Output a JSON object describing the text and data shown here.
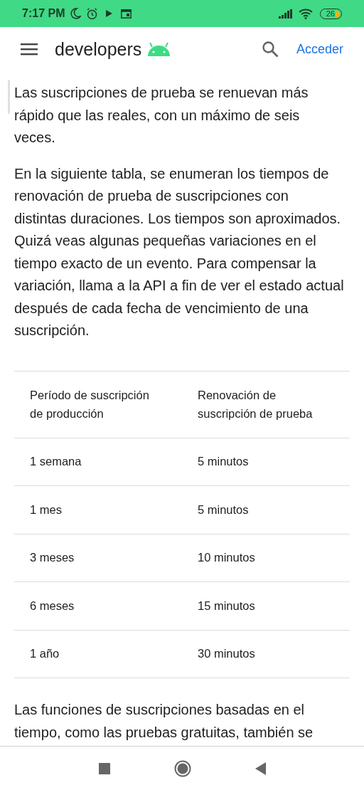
{
  "status_bar": {
    "time": "7:17 PM",
    "battery": "26"
  },
  "header": {
    "logo": "developers",
    "sign_in": "Acceder"
  },
  "paragraphs": [
    "Las suscripciones de prueba se renuevan más rápido que las reales, con un máximo de seis veces.",
    "En la siguiente tabla, se enumeran los tiempos de renovación de prueba de suscripciones con distintas duraciones. Los tiempos son aproximados. Quizá veas algunas pequeñas variaciones en el tiempo exacto de un evento. Para compensar la variación, llama a la API a fin de ver el estado actual después de cada fecha de vencimiento de una suscripción."
  ],
  "table": {
    "columns": [
      "Período de suscripción de producción",
      "Renovación de suscripción de prueba"
    ],
    "rows": [
      [
        "1 semana",
        "5 minutos"
      ],
      [
        "1 mes",
        "5 minutos"
      ],
      [
        "3 meses",
        "10 minutos"
      ],
      [
        "6 meses",
        "15 minutos"
      ],
      [
        "1 año",
        "30 minutos"
      ]
    ]
  },
  "trailing_paragraph": "Las funciones de suscripciones basadas en el tiempo, como las pruebas gratuitas, también se"
}
